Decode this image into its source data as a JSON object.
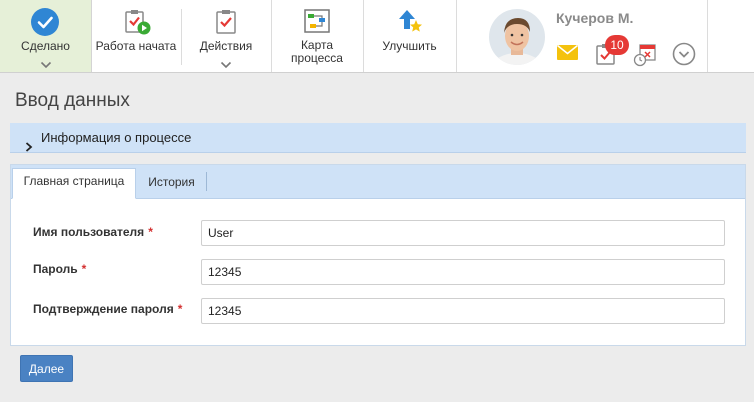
{
  "toolbar": {
    "done_label": "Сделано",
    "work_started_label": "Работа начата",
    "actions_label": "Действия",
    "process_map_line1": "Карта",
    "process_map_line2": "процесса",
    "improve_label": "Улучшить"
  },
  "profile": {
    "name": "Кучеров М.",
    "task_count": "10",
    "icons": [
      "mail-icon",
      "tasks-icon",
      "calendar-icon",
      "chevron-down-circle-icon"
    ]
  },
  "page": {
    "title": "Ввод данных",
    "info_section": "Информация о процессе"
  },
  "tabs": [
    {
      "label": "Главная страница",
      "active": true
    },
    {
      "label": "История",
      "active": false
    }
  ],
  "form": {
    "username": {
      "label": "Имя пользователя",
      "value": "User"
    },
    "password": {
      "label": "Пароль",
      "value": "12345"
    },
    "password_confirm": {
      "label": "Подтверждение пароля",
      "value": "12345"
    },
    "required_mark": "*"
  },
  "buttons": {
    "next": "Далее"
  },
  "colors": {
    "accent": "#2f86d4",
    "done_bg": "#e6f0d8",
    "header_bar": "#cfe2f7",
    "primary_button": "#4a82c3",
    "badge": "#e53935",
    "required": "#d32f2f"
  }
}
